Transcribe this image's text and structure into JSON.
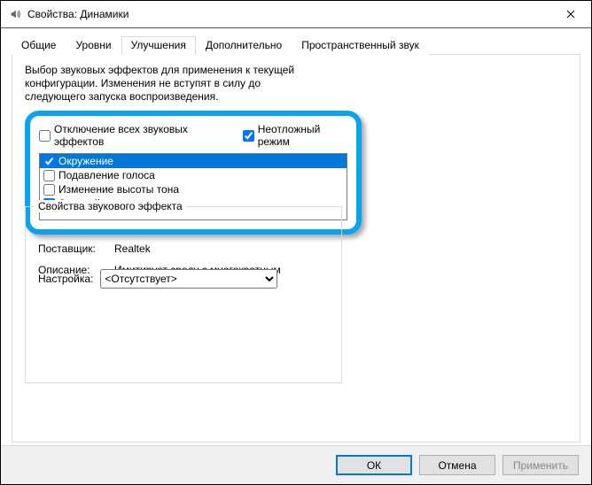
{
  "titlebar": {
    "title": "Свойства: Динамики"
  },
  "tabs": {
    "general": "Общие",
    "levels": "Уровни",
    "enhancements": "Улучшения",
    "advanced": "Дополнительно",
    "spatial": "Пространственный звук"
  },
  "intro": "Выбор звуковых эффектов для применения к текущей конфигурации. Изменения не вступят в силу до следующего запуска воспроизведения.",
  "topchecks": {
    "disable_all": {
      "label": "Отключение всех звуковых эффектов",
      "checked": false
    },
    "immediate": {
      "label": "Неотложный режим",
      "checked": true
    }
  },
  "effects": [
    {
      "label": "Окружение",
      "checked": true,
      "selected": true
    },
    {
      "label": "Подавление голоса",
      "checked": false
    },
    {
      "label": "Изменение высоты тона",
      "checked": false
    },
    {
      "label": "Эквалайзер",
      "checked": true
    }
  ],
  "group": {
    "legend": "Свойства звукового эффекта",
    "provider_k": "Поставщик:",
    "provider_v": "Realtek",
    "desc_k": "Описание:",
    "desc_v": "Имитирует среду с многократным воспроизведением.",
    "setting_k": "Настройка:",
    "setting_v": "<Отсутствует>"
  },
  "buttons": {
    "ok": "ОК",
    "cancel": "Отмена",
    "apply": "Применить"
  }
}
